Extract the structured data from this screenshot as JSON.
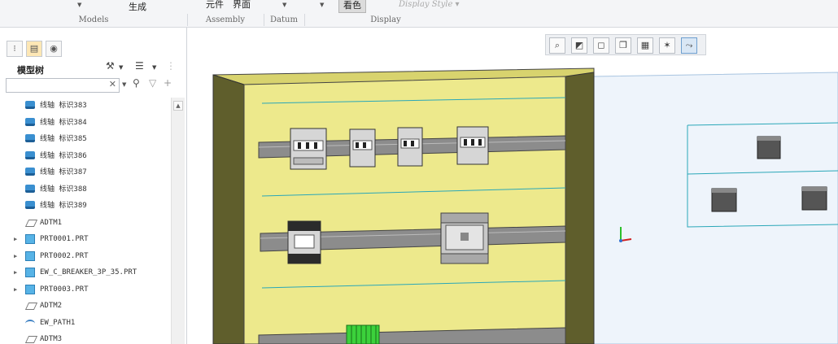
{
  "ribbon": {
    "top_labels": [
      "生成",
      "元件",
      "界面",
      "看色"
    ],
    "display_style": "Display Style",
    "groups": [
      "Models",
      "Assembly",
      "Datum",
      "Display"
    ]
  },
  "left_panel": {
    "title": "模型树",
    "search_value": "",
    "items": [
      {
        "icon": "harness-icon",
        "label": "线轴 标识383",
        "expandable": false
      },
      {
        "icon": "harness-icon",
        "label": "线轴 标识384",
        "expandable": false
      },
      {
        "icon": "harness-icon",
        "label": "线轴 标识385",
        "expandable": false
      },
      {
        "icon": "harness-icon",
        "label": "线轴 标识386",
        "expandable": false
      },
      {
        "icon": "harness-icon",
        "label": "线轴 标识387",
        "expandable": false
      },
      {
        "icon": "harness-icon",
        "label": "线轴 标识388",
        "expandable": false
      },
      {
        "icon": "harness-icon",
        "label": "线轴 标识389",
        "expandable": false
      },
      {
        "icon": "datum-plane-icon",
        "label": "ADTM1",
        "expandable": false
      },
      {
        "icon": "part-icon",
        "label": "PRT0001.PRT",
        "expandable": true
      },
      {
        "icon": "part-icon",
        "label": "PRT0002.PRT",
        "expandable": true
      },
      {
        "icon": "part-icon",
        "label": "EW_C_BREAKER_3P_35.PRT",
        "expandable": true
      },
      {
        "icon": "part-icon",
        "label": "PRT0003.PRT",
        "expandable": true
      },
      {
        "icon": "datum-plane-icon",
        "label": "ADTM2",
        "expandable": false
      },
      {
        "icon": "path-icon",
        "label": "EW_PATH1",
        "expandable": false
      },
      {
        "icon": "datum-plane-icon",
        "label": "ADTM3",
        "expandable": false
      }
    ]
  },
  "viewport": {
    "toolbar_icons": [
      "zoom-icon",
      "refit-icon",
      "display-style-icon",
      "saved-views-icon",
      "datum-display-icon",
      "spin-center-icon",
      "annotation-display-icon"
    ],
    "colors": {
      "panel_face": "#ede98c",
      "panel_side": "#5f5e2c",
      "panel_top": "#d8d36e",
      "rail": "#8c8c8c",
      "wire": "#2aa7b8",
      "terminal": "#3bd13b",
      "plane": "#eef4fb"
    }
  }
}
